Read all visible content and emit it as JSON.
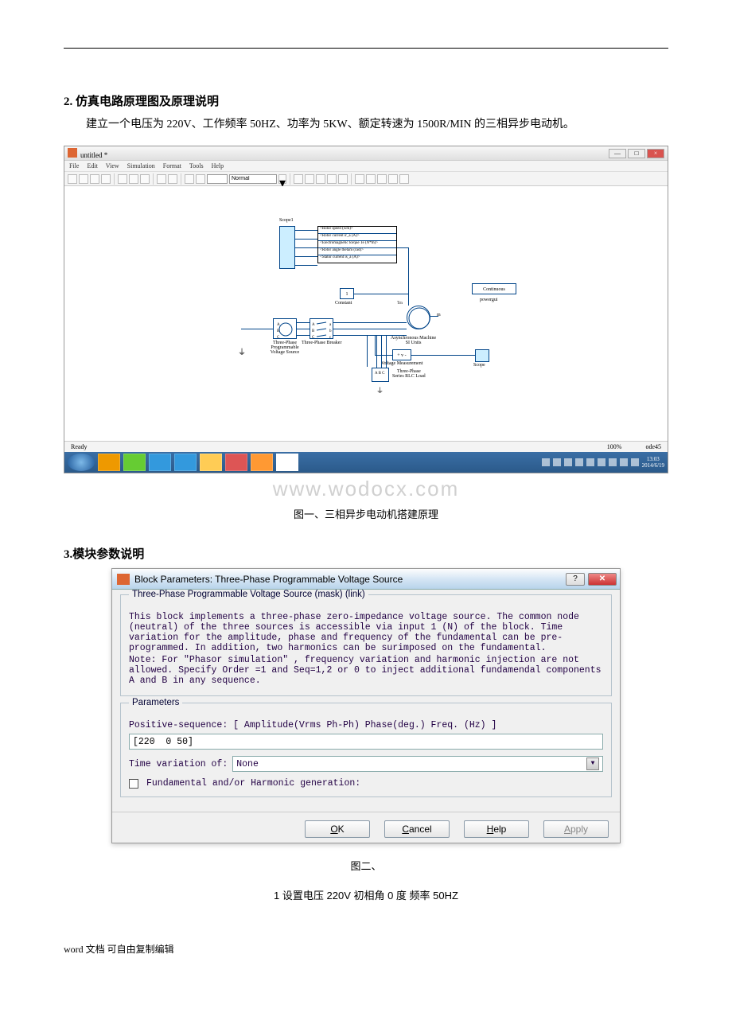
{
  "section2": {
    "heading": "2. 仿真电路原理图及原理说明",
    "paragraph": "建立一个电压为 220V、工作频率 50HZ、功率为 5KW、额定转速为 1500R/MIN 的三相异步电动机。"
  },
  "simulink": {
    "title": "untitled *",
    "menu": [
      "File",
      "Edit",
      "View",
      "Simulation",
      "Format",
      "Tools",
      "Help"
    ],
    "simmode": "Normal",
    "status_left": "Ready",
    "status_zoom": "100%",
    "status_solver": "ode45",
    "scope1": "Scope1",
    "bus_signals": [
      "<Rotor speed (wm)>",
      "<Rotor current ir_a (A)>",
      "<Electromagnetic torque Te (N*m)>",
      "<Rotor angle thetam (rad)>",
      "<Stator current is_a (A)>"
    ],
    "constant": "1",
    "constant_label": "Constant",
    "powergui": "Continuous",
    "powergui_label": "powergui",
    "src_label": "Three-Phase\nProgrammable\nVoltage Source",
    "breaker_label": "Three-Phase Breaker",
    "machine_label": "Asynchronous Machine\nSI Units",
    "vm_label": "Voltage Measurement",
    "rlc_label": "Three-Phase\nSeries RLC Load",
    "scope_label": "Scope",
    "tm": "Tm"
  },
  "taskbar": {
    "time": "13:03",
    "date": "2014/6/19"
  },
  "watermark": "www.wodocx.com",
  "caption1": "图一、三相异步电动机搭建原理",
  "section3": {
    "heading": "3.模块参数说明"
  },
  "dialog": {
    "title": "Block Parameters: Three-Phase Programmable Voltage Source",
    "mask_title": "Three-Phase Programmable Voltage Source (mask) (link)",
    "desc1": "This block implements a three-phase zero-impedance voltage source.  The common node (neutral) of the three sources is accessible via input 1 (N) of the block. Time variation for the amplitude, phase and frequency of the fundamental can be pre-programmed.  In addition, two harmonics can be surimposed on the fundamental.",
    "desc2": "Note: For  \"Phasor simulation\" , frequency variation and harmonic injection are not allowed.  Specify  Order =1 and Seq=1,2 or 0 to inject additional fundamendal components A and B in  any sequence.",
    "params_title": "Parameters",
    "posseq_label": "Positive-sequence: [ Amplitude(Vrms Ph-Ph)  Phase(deg.)   Freq. (Hz) ]",
    "posseq_value": "[220  0 50]",
    "timevar_label": "Time variation of:",
    "timevar_value": "None",
    "harmonic_label": "Fundamental and/or Harmonic generation:",
    "buttons": {
      "ok": "OK",
      "cancel": "Cancel",
      "help": "Help",
      "apply": "Apply"
    }
  },
  "caption2": "图二、",
  "caption3": "1 设置电压 220V 初相角 0 度  频率 50HZ",
  "footer": "word 文档 可自由复制编辑"
}
